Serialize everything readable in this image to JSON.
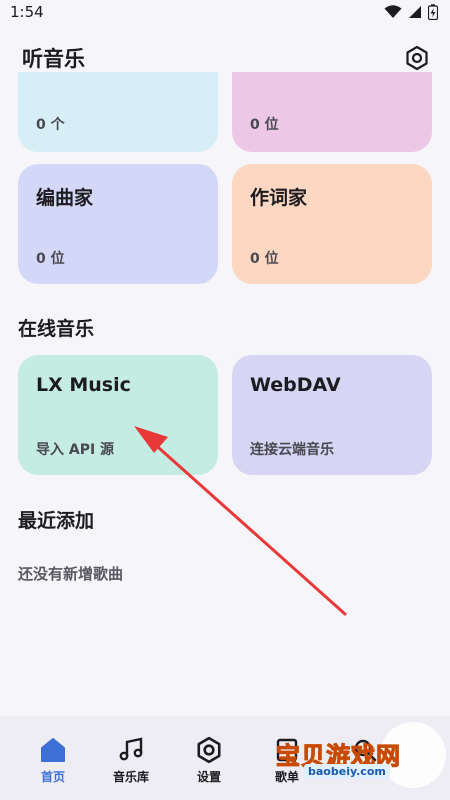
{
  "status": {
    "time": "1:54"
  },
  "header": {
    "title": "听音乐"
  },
  "local_cards": [
    {
      "subtitle": "0 个",
      "bg": "#d6eef6"
    },
    {
      "subtitle": "0 位",
      "bg": "#ecc8e6"
    },
    {
      "title": "编曲家",
      "subtitle": "0 位",
      "bg": "#d4d8f8"
    },
    {
      "title": "作词家",
      "subtitle": "0 位",
      "bg": "#fdd7c1"
    }
  ],
  "online": {
    "section_title": "在线音乐",
    "cards": [
      {
        "title": "LX Music",
        "subtitle": "导入 API 源",
        "bg": "#c4ece3"
      },
      {
        "title": "WebDAV",
        "subtitle": "连接云端音乐",
        "bg": "#d6d5f4"
      }
    ]
  },
  "recent": {
    "section_title": "最近添加",
    "empty_text": "还没有新增歌曲"
  },
  "nav": [
    {
      "label": "首页",
      "icon": "home-icon",
      "active": true
    },
    {
      "label": "音乐库",
      "icon": "music-note-icon"
    },
    {
      "label": "设置",
      "icon": "gear-icon"
    },
    {
      "label": "歌单",
      "icon": "playlist-icon"
    },
    {
      "label": "",
      "icon": "search-icon"
    }
  ],
  "watermark": {
    "text": "宝贝游戏网",
    "url": "baobeiy.com"
  },
  "colors": {
    "accent": "#3d6fd6",
    "arrow": "#e8393a"
  }
}
